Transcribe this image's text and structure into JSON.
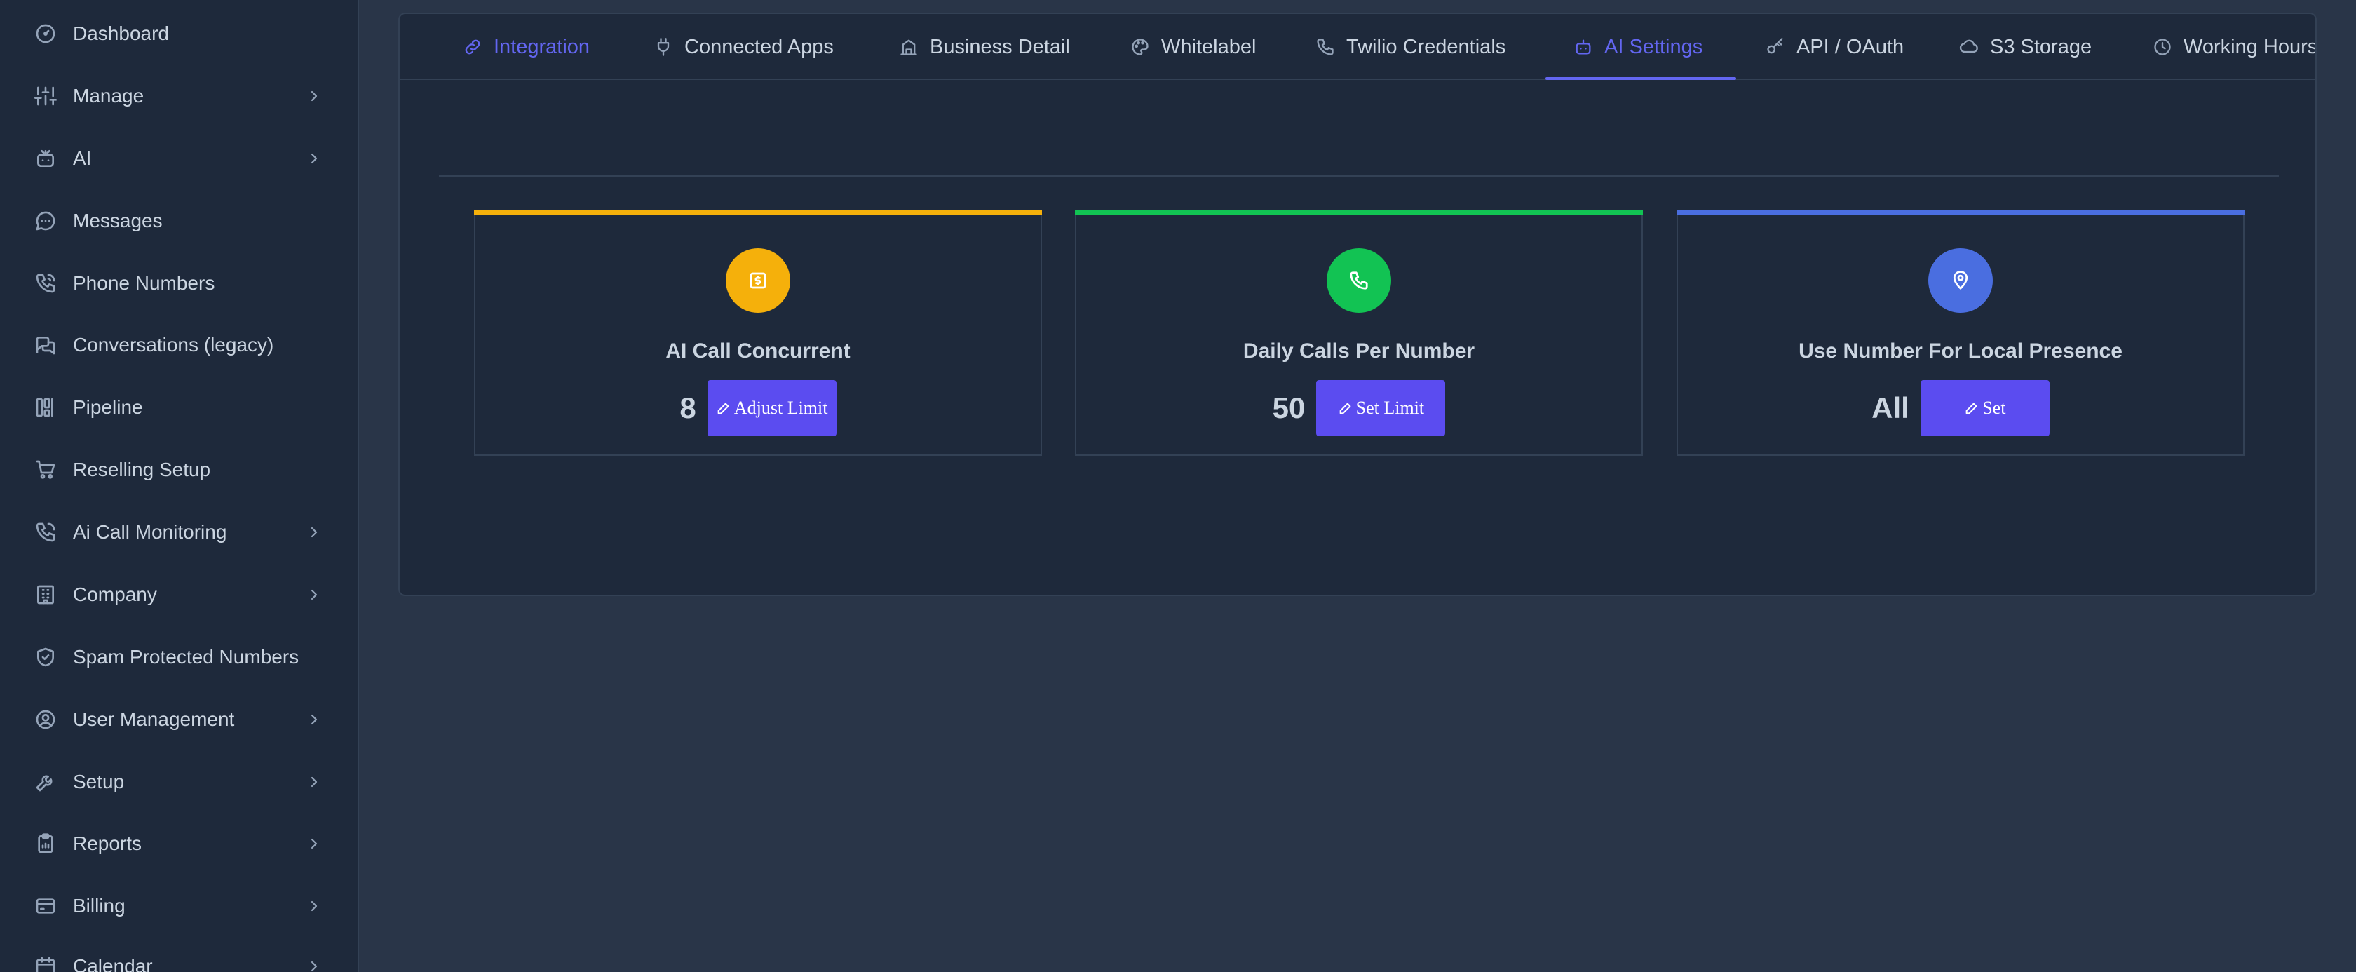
{
  "sidebar": {
    "items": [
      {
        "label": "Dashboard",
        "icon": "gauge-icon",
        "has_submenu": false
      },
      {
        "label": "Manage",
        "icon": "sliders-icon",
        "has_submenu": true
      },
      {
        "label": "AI",
        "icon": "robot-icon",
        "has_submenu": true
      },
      {
        "label": "Messages",
        "icon": "chat-icon",
        "has_submenu": false
      },
      {
        "label": "Phone Numbers",
        "icon": "phone-icon",
        "has_submenu": false
      },
      {
        "label": "Conversations (legacy)",
        "icon": "conversations-icon",
        "has_submenu": false
      },
      {
        "label": "Pipeline",
        "icon": "pipeline-icon",
        "has_submenu": false
      },
      {
        "label": "Reselling Setup",
        "icon": "cart-icon",
        "has_submenu": false
      },
      {
        "label": "Ai Call Monitoring",
        "icon": "phone-call-icon",
        "has_submenu": true
      },
      {
        "label": "Company",
        "icon": "building-icon",
        "has_submenu": true
      },
      {
        "label": "Spam Protected Numbers",
        "icon": "shield-check-icon",
        "has_submenu": false
      },
      {
        "label": "User Management",
        "icon": "user-circle-icon",
        "has_submenu": true
      },
      {
        "label": "Setup",
        "icon": "wrench-icon",
        "has_submenu": true
      },
      {
        "label": "Reports",
        "icon": "clipboard-icon",
        "has_submenu": true
      },
      {
        "label": "Billing",
        "icon": "credit-card-icon",
        "has_submenu": true
      },
      {
        "label": "Calendar",
        "icon": "calendar-icon",
        "has_submenu": true
      }
    ]
  },
  "tabs": [
    {
      "label": "Integration",
      "icon": "link-icon",
      "active": true
    },
    {
      "label": "Connected Apps",
      "icon": "plug-icon",
      "active": false
    },
    {
      "label": "Business Detail",
      "icon": "building-icon",
      "active": false
    },
    {
      "label": "Whitelabel",
      "icon": "palette-icon",
      "active": false
    },
    {
      "label": "Twilio Credentials",
      "icon": "phone-icon",
      "active": false
    },
    {
      "label": "AI Settings",
      "icon": "robot-icon",
      "active": true
    },
    {
      "label": "API / OAuth",
      "icon": "key-icon",
      "active": false
    },
    {
      "label": "S3 Storage",
      "icon": "cloud-icon",
      "active": false
    },
    {
      "label": "Working Hours",
      "icon": "clock-icon",
      "active": false
    }
  ],
  "cards": [
    {
      "title": "AI Call Concurrent",
      "value": "8",
      "button_label": "Adjust Limit",
      "icon": "dollar-square-icon",
      "color": "#f5b00b"
    },
    {
      "title": "Daily Calls Per Number",
      "value": "50",
      "button_label": "Set Limit",
      "icon": "phone-icon",
      "color": "#12c353"
    },
    {
      "title": "Use Number For Local Presence",
      "value": "All",
      "button_label": "Set",
      "icon": "map-pin-icon",
      "color": "#4a6ee0"
    }
  ],
  "colors": {
    "accent": "#6366f1",
    "button": "#5b4cf0",
    "sidebar_bg": "#1e293b",
    "page_bg": "#293548"
  }
}
